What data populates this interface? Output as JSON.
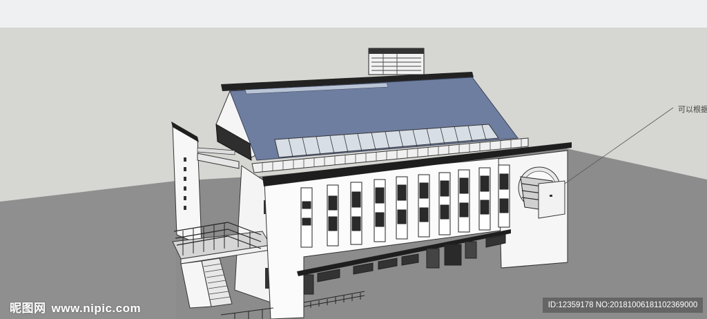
{
  "annotation": {
    "text": "可以根据"
  },
  "watermark": {
    "brand": "昵图网",
    "url": "www.nipic.com"
  },
  "image_id": {
    "text": "ID:12359178 NO:20181006181102369000"
  }
}
